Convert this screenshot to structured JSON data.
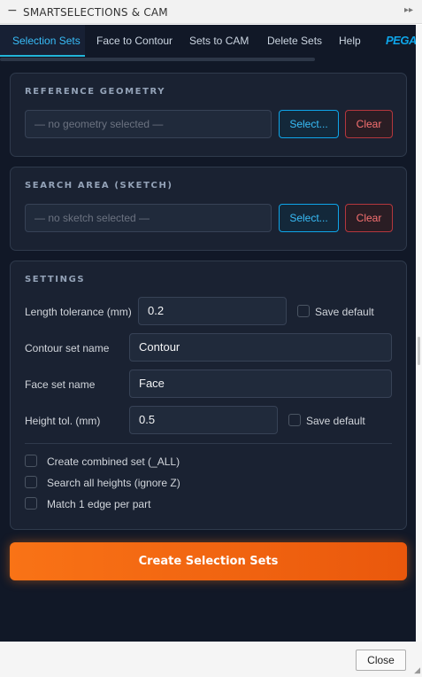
{
  "window": {
    "title": "SMARTSELECTIONS & CAM",
    "collapse_glyph": "−",
    "expand_glyph": "▸▸",
    "collapse_icon": "minus-icon",
    "expand_icon": "double-chevron-right-icon"
  },
  "tabs": [
    {
      "label": "Selection Sets",
      "active": true
    },
    {
      "label": "Face to Contour",
      "active": false
    },
    {
      "label": "Sets to CAM",
      "active": false
    },
    {
      "label": "Delete Sets",
      "active": false
    },
    {
      "label": "Help",
      "active": false
    }
  ],
  "brand": {
    "logo_text": "PEGAS"
  },
  "reference_geometry": {
    "heading": "REFERENCE GEOMETRY",
    "placeholder": "— no geometry selected —",
    "select_label": "Select...",
    "clear_label": "Clear"
  },
  "search_area": {
    "heading": "SEARCH AREA (SKETCH)",
    "placeholder": "— no sketch selected —",
    "select_label": "Select...",
    "clear_label": "Clear"
  },
  "settings": {
    "heading": "SETTINGS",
    "length_tolerance": {
      "label": "Length tolerance (mm)",
      "value": "0.2",
      "save_default_label": "Save default",
      "save_default_checked": false
    },
    "contour_set_name": {
      "label": "Contour set name",
      "value": "Contour"
    },
    "face_set_name": {
      "label": "Face set name",
      "value": "Face"
    },
    "height_tolerance": {
      "label": "Height tol. (mm)",
      "value": "0.5",
      "save_default_label": "Save default",
      "save_default_checked": false
    },
    "options": [
      {
        "label": "Create combined set (_ALL)",
        "checked": false
      },
      {
        "label": "Search all heights (ignore Z)",
        "checked": false
      },
      {
        "label": "Match 1 edge per part",
        "checked": false
      }
    ]
  },
  "create_button_label": "Create Selection Sets",
  "footer": {
    "close_label": "Close",
    "resize_glyph": "◢"
  },
  "colors": {
    "panel_bg": "#111827",
    "card_bg": "#1a2232",
    "accent": "#38bdf8",
    "danger": "#f87171",
    "primary_orange": "#f97316"
  }
}
